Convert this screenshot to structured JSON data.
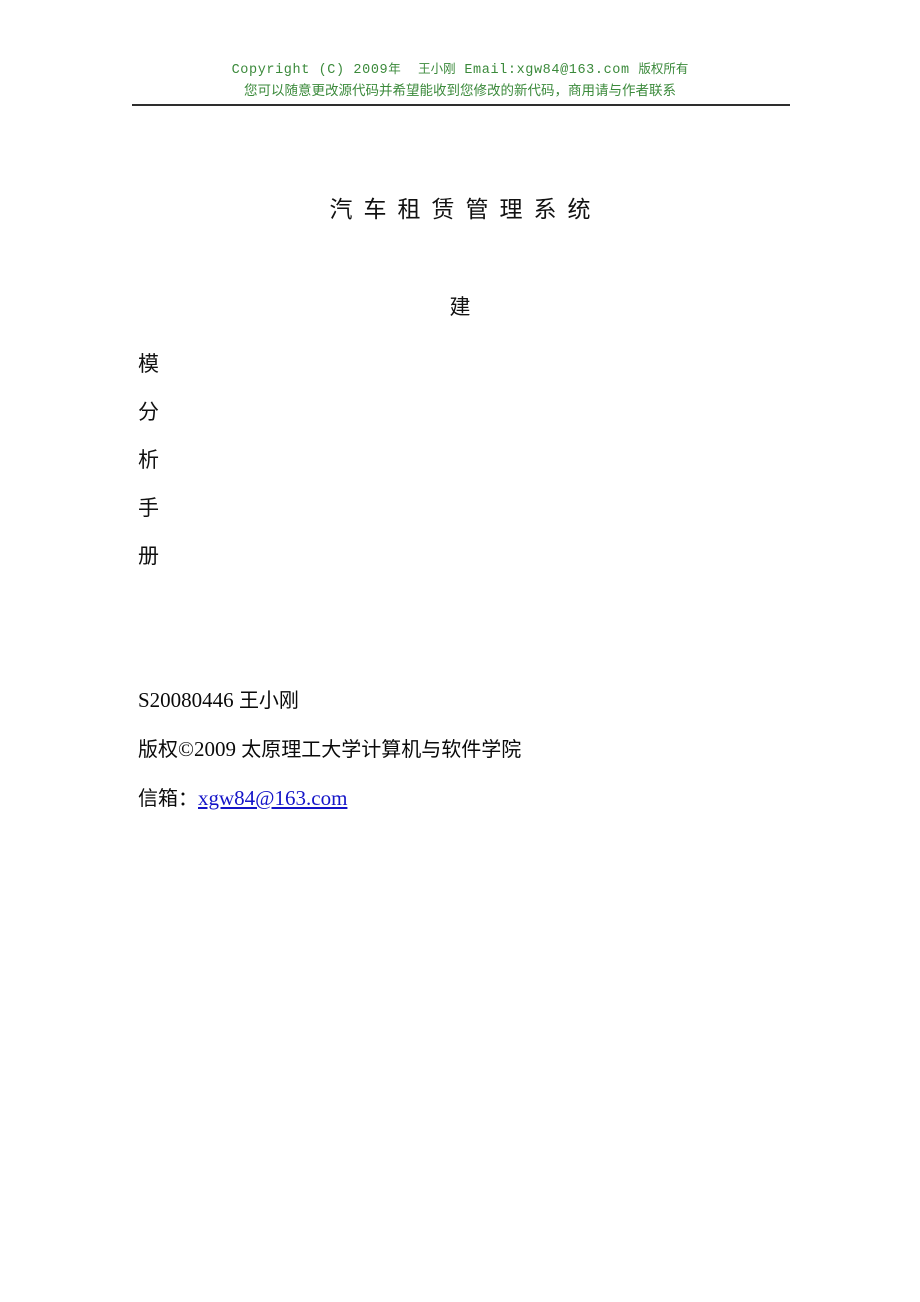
{
  "header": {
    "line1_latin_a": "Copyright (C) 2009",
    "line1_cjk_a": "年",
    "line1_cjk_b": "王小刚",
    "line1_latin_b": "Email:xgw84@163.com",
    "line1_cjk_c": "版权所有",
    "line2": "您可以随意更改源代码并希望能收到您修改的新代码，商用请与作者联系",
    "color": "#3b8a3b",
    "rule_color": "#2e2e2e"
  },
  "title": {
    "text": "汽车租赁管理系统"
  },
  "subtitle": {
    "centered_char": "建",
    "column_chars": [
      "模",
      "分",
      "析",
      "手",
      "册"
    ],
    "full_text": "建模分析手册"
  },
  "meta": {
    "student_id_latin": "S20080446 ",
    "student_name": "王小刚",
    "copyright_cjk": "版权",
    "copyright_symbol_year": "©2009 ",
    "institution": "太原理工大学计算机与软件学院",
    "email_label": "信箱：",
    "email_value": "xgw84@163.com",
    "email_color": "#1414c8"
  }
}
